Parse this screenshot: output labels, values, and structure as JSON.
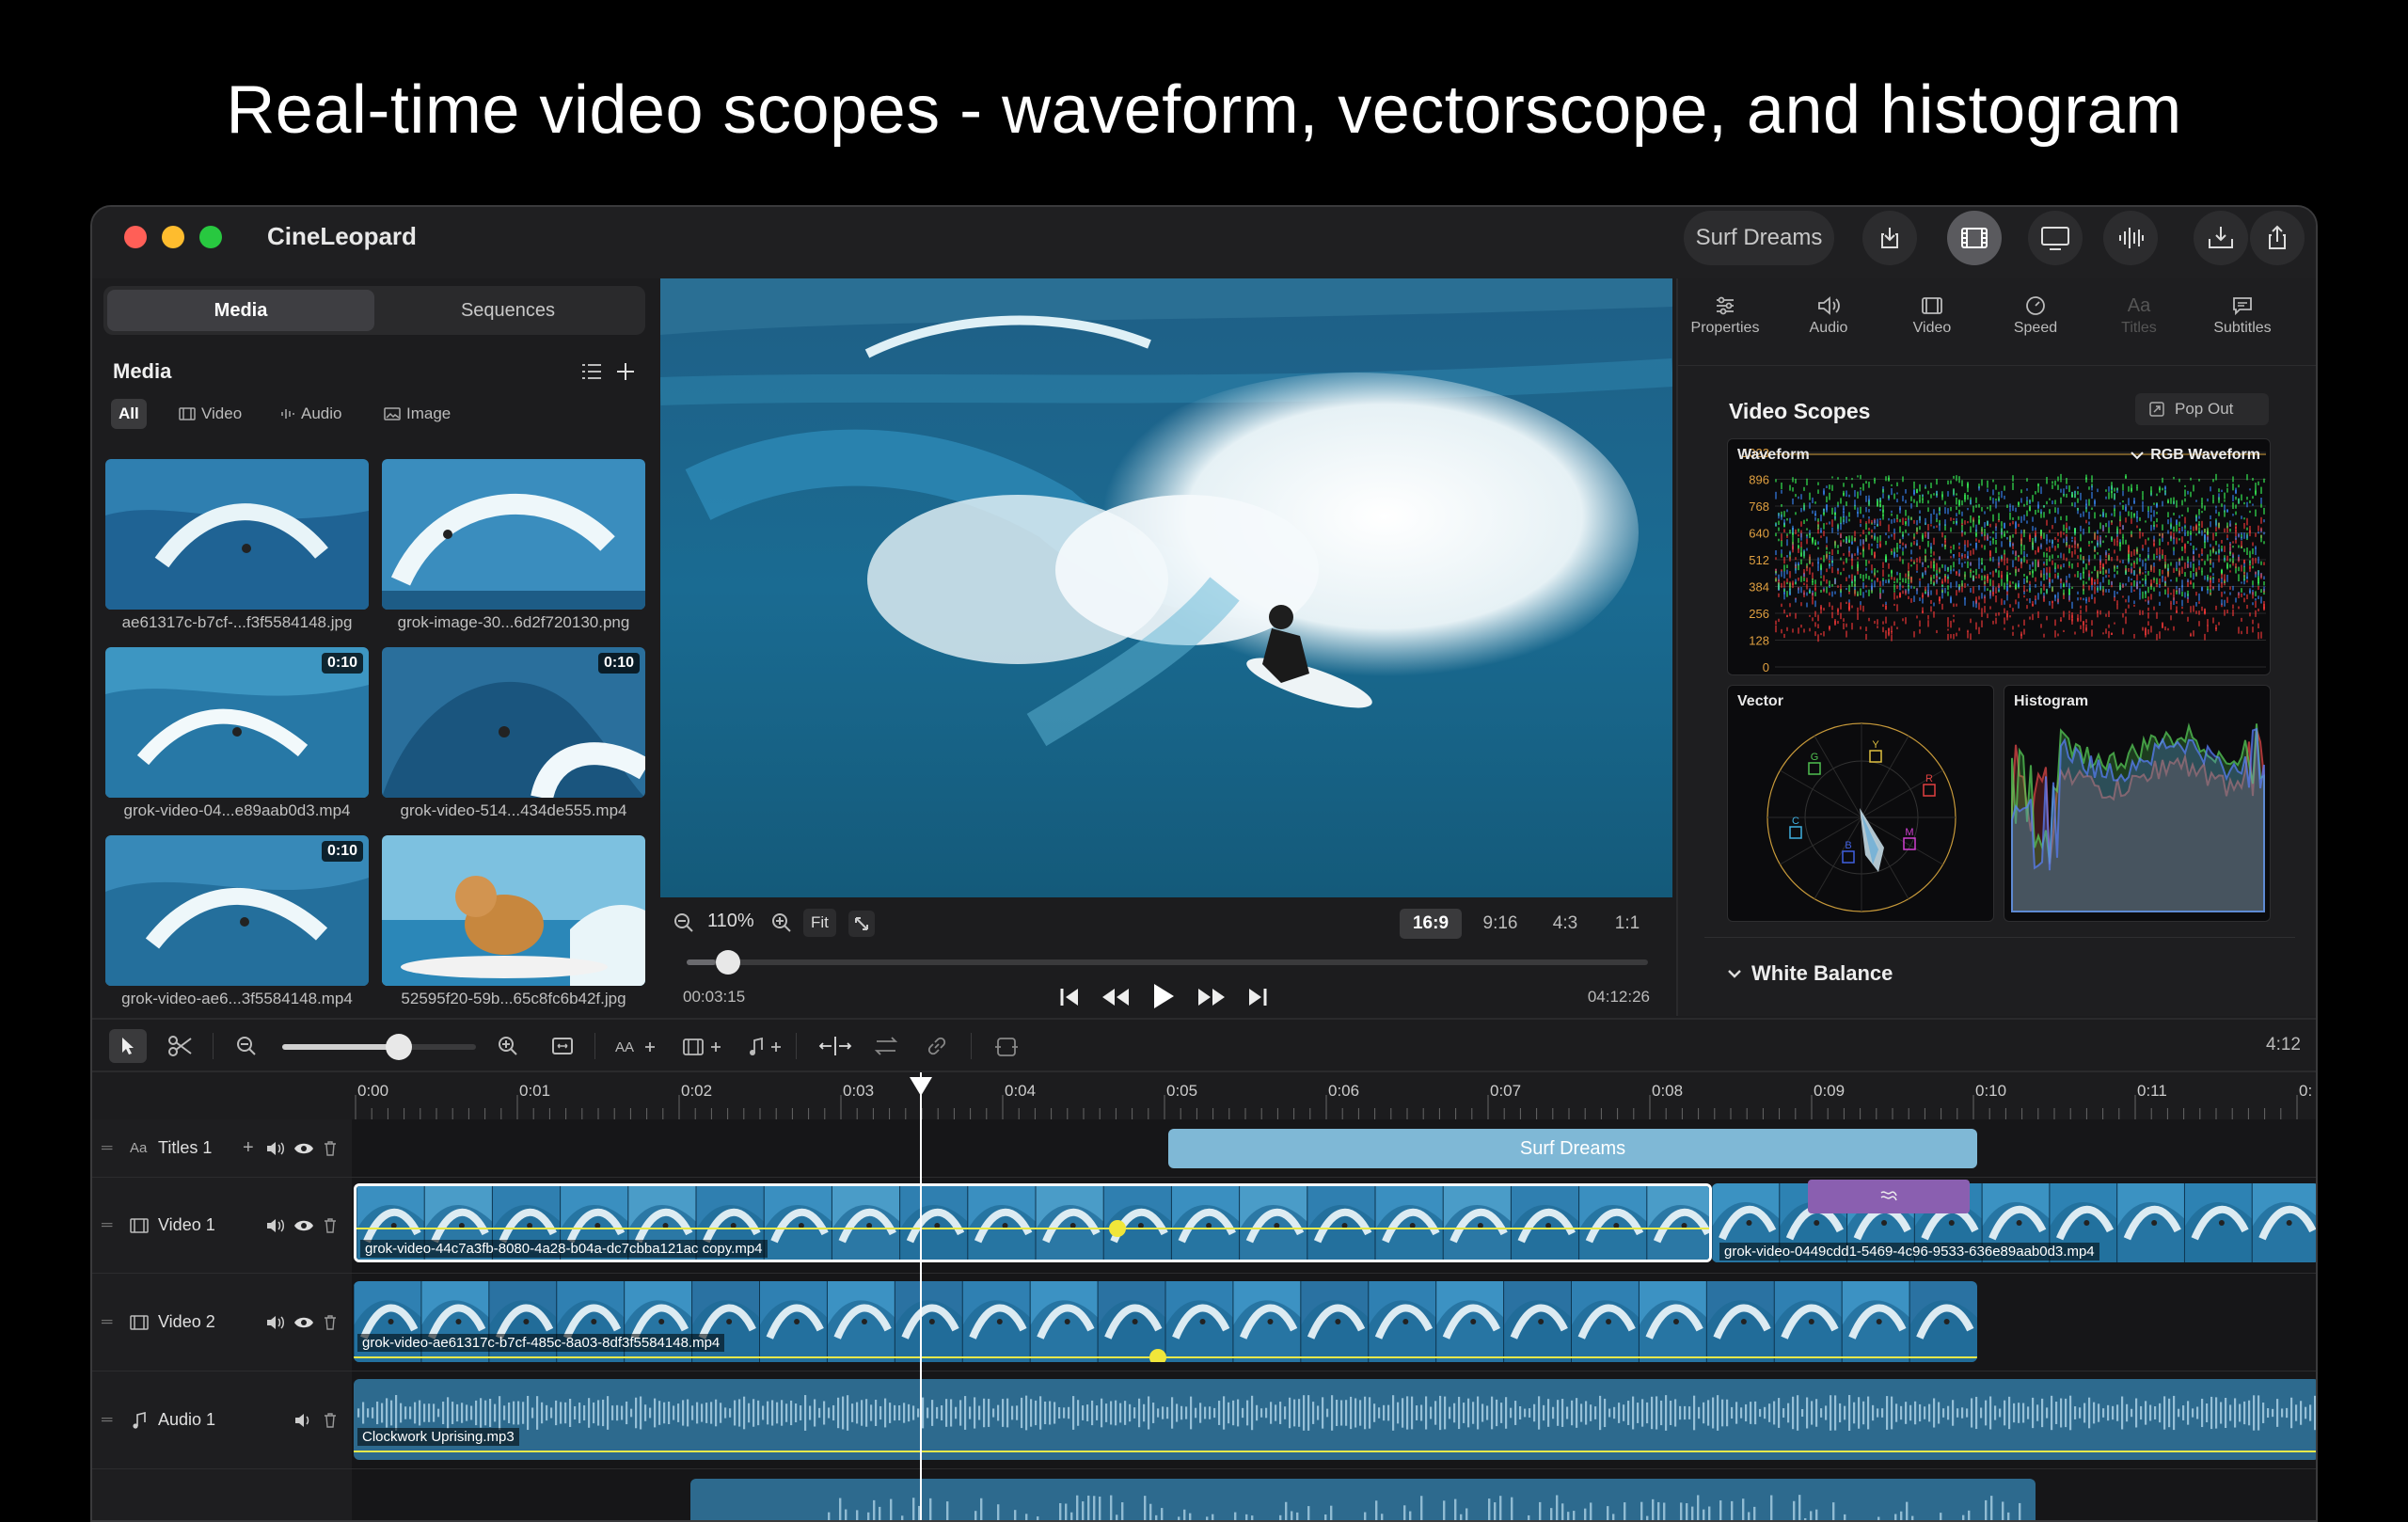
{
  "headline": "Real-time video scopes - waveform, vectorscope, and histogram",
  "app": {
    "title": "CineLeopard",
    "project_name": "Surf Dreams"
  },
  "colors": {
    "accent": "#3b82c4",
    "title_clip": "#7fb8d6",
    "audio_clip": "#2d6a8e",
    "purple_clip": "#8a5fb0",
    "traffic_red": "#ff5f57",
    "traffic_yellow": "#febc2e",
    "traffic_green": "#28c840"
  },
  "left_panel": {
    "tabs": [
      "Media",
      "Sequences"
    ],
    "active_tab": "Media",
    "title": "Media",
    "filters": [
      "All",
      "Video",
      "Audio",
      "Image"
    ],
    "active_filter": "All",
    "items": [
      {
        "name": "ae61317c-b7cf-...f3f5584148.jpg",
        "duration": "",
        "icon": "wave-photo"
      },
      {
        "name": "grok-image-30...6d2f720130.png",
        "duration": "",
        "icon": "wave-photo"
      },
      {
        "name": "grok-video-04...e89aab0d3.mp4",
        "duration": "0:10",
        "icon": "wave-video"
      },
      {
        "name": "grok-video-514...434de555.mp4",
        "duration": "0:10",
        "icon": "wave-video"
      },
      {
        "name": "grok-video-ae6...3f5584148.mp4",
        "duration": "0:10",
        "icon": "wave-video"
      },
      {
        "name": "52595f20-59b...65c8fc6b42f.jpg",
        "duration": "",
        "icon": "dog-surf-photo"
      }
    ]
  },
  "viewer": {
    "zoom": "110%",
    "fit_label": "Fit",
    "aspect_ratios": [
      "16:9",
      "9:16",
      "4:3",
      "1:1"
    ],
    "active_aspect": "16:9",
    "current_time": "00:03:15",
    "total_time": "04:12:26",
    "scrub_fraction": 0.03
  },
  "inspector": {
    "tabs": [
      "Properties",
      "Audio",
      "Video",
      "Speed",
      "Titles",
      "Subtitles"
    ],
    "disabled_tab": "Titles",
    "scopes_title": "Video Scopes",
    "pop_out": "Pop Out",
    "waveform_label": "Waveform",
    "waveform_mode": "RGB Waveform",
    "waveform_scale": [
      "1023",
      "896",
      "768",
      "640",
      "512",
      "384",
      "256",
      "128",
      "0"
    ],
    "vector_label": "Vector",
    "vector_targets": [
      "Y",
      "R",
      "M",
      "B",
      "C",
      "G"
    ],
    "histogram_label": "Histogram",
    "white_balance": "White Balance"
  },
  "timeline": {
    "duration_label": "4:12",
    "zoom_fraction": 0.6,
    "ruler": [
      "0:00",
      "0:01",
      "0:02",
      "0:03",
      "0:04",
      "0:05",
      "0:06",
      "0:07",
      "0:08",
      "0:09",
      "0:10",
      "0:11",
      "0:"
    ],
    "tracks": [
      {
        "name": "Titles 1",
        "kind": "titles"
      },
      {
        "name": "Video 1",
        "kind": "video"
      },
      {
        "name": "Video 2",
        "kind": "video"
      },
      {
        "name": "Audio 1",
        "kind": "audio"
      }
    ],
    "title_clip": "Surf Dreams",
    "video1_clip_a": "grok-video-44c7a3fb-8080-4a28-b04a-dc7cbba121ac copy.mp4",
    "video1_clip_b": "grok-video-0449cdd1-5469-4c96-9533-636e89aab0d3.mp4",
    "video2_clip": "grok-video-ae61317c-b7cf-485c-8a03-8df3f5584148.mp4",
    "audio_clip": "Clockwork Uprising.mp3"
  }
}
